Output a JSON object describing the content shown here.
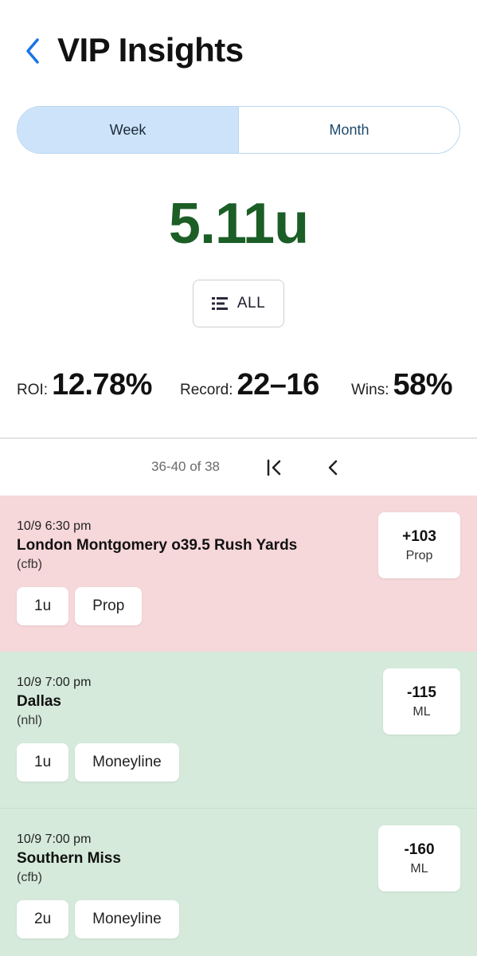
{
  "header": {
    "back_icon": "chevron-left-icon",
    "title": "VIP Insights"
  },
  "period_toggle": {
    "week": "Week",
    "month": "Month",
    "selected": "Week"
  },
  "summary": {
    "units": "5.11u"
  },
  "filter": {
    "icon": "list-filter-icon",
    "label": "ALL"
  },
  "stats": {
    "roi_label": "ROI:",
    "roi_value": "12.78%",
    "record_label": "Record:",
    "record_value": "22–16",
    "wins_label": "Wins:",
    "wins_value": "58%"
  },
  "pagination": {
    "range_text": "36-40 of 38",
    "first_icon": "first-page-icon",
    "prev_icon": "chevron-left-icon"
  },
  "picks": [
    {
      "result": "loss",
      "time": "10/9 6:30 pm",
      "name": "London Montgomery o39.5 Rush Yards",
      "league": "(cfb)",
      "units": "1u",
      "bet_type": "Prop",
      "odds": "+103",
      "odds_type": "Prop"
    },
    {
      "result": "win",
      "time": "10/9 7:00 pm",
      "name": "Dallas",
      "league": "(nhl)",
      "units": "1u",
      "bet_type": "Moneyline",
      "odds": "-115",
      "odds_type": "ML"
    },
    {
      "result": "win",
      "time": "10/9 7:00 pm",
      "name": "Southern Miss",
      "league": "(cfb)",
      "units": "2u",
      "bet_type": "Moneyline",
      "odds": "-160",
      "odds_type": "ML"
    }
  ],
  "colors": {
    "units_green": "#1b5e26",
    "loss_bg": "#f6d7da",
    "win_bg": "#d5eadb",
    "accent_blue": "#1a73e8",
    "toggle_active": "#cce3f9"
  }
}
